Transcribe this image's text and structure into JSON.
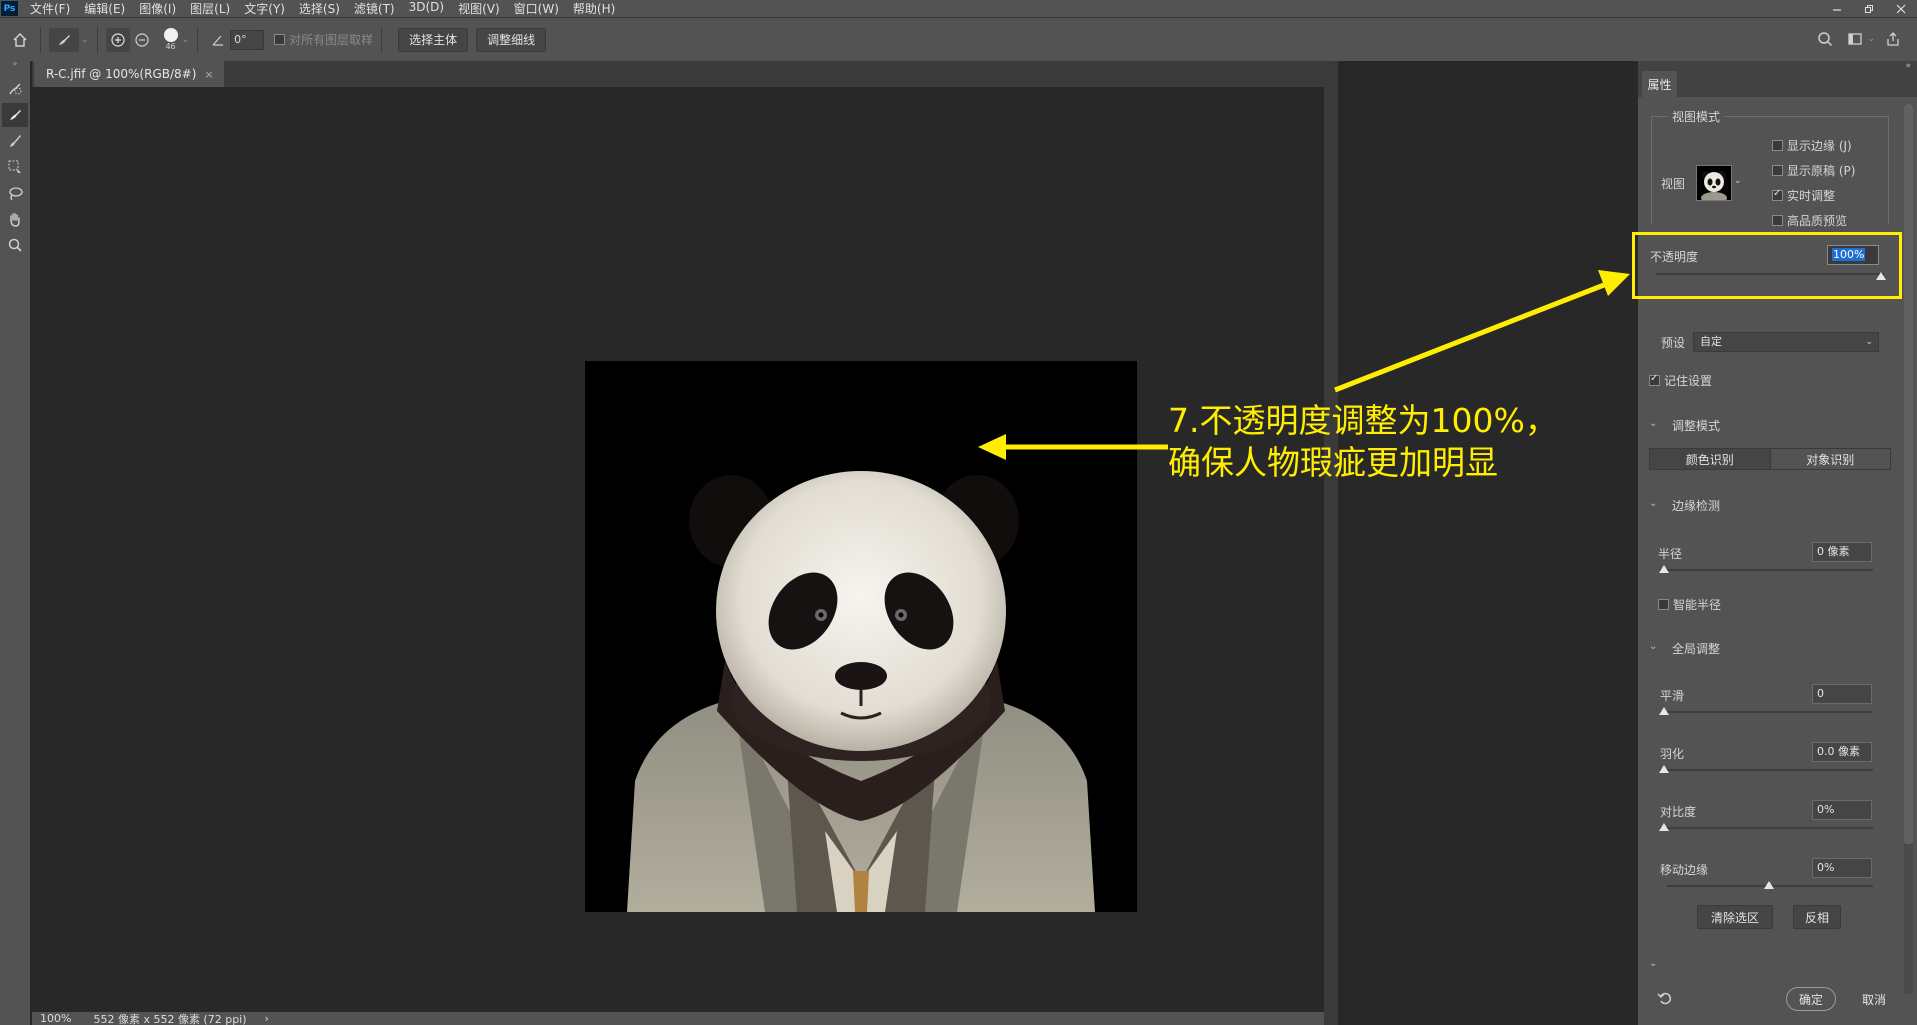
{
  "app": {
    "logo": "Ps",
    "menu": [
      "文件(F)",
      "编辑(E)",
      "图像(I)",
      "图层(L)",
      "文字(Y)",
      "选择(S)",
      "滤镜(T)",
      "3D(D)",
      "视图(V)",
      "窗口(W)",
      "帮助(H)"
    ]
  },
  "options_bar": {
    "brush_size": "46",
    "angle": "0°",
    "sample_all_layers": "对所有图层取样",
    "select_subject": "选择主体",
    "refine_hair": "调整细线"
  },
  "document": {
    "tab_title": "R-C.jfif @ 100%(RGB/8#)",
    "tab_close": "×"
  },
  "status": {
    "zoom": "100%",
    "doc_info": "552 像素 x 552 像素 (72 ppi)",
    "arrow": "›"
  },
  "annotation": {
    "line1": "7.不透明度调整为100%，",
    "line2": "确保人物瑕疵更加明显",
    "color": "#ffee00"
  },
  "properties": {
    "tab": "属性",
    "view_mode_title": "视图模式",
    "view_label": "视图",
    "show_edge": "显示边缘 (J)",
    "show_original": "显示原稿 (P)",
    "realtime": "实时调整",
    "high_quality": "高品质预览",
    "opacity_label": "不透明度",
    "opacity_value": "100%",
    "opacity_level": 100,
    "preset_label": "预设",
    "preset_value": "自定",
    "remember": "记住设置",
    "adjust_mode_title": "调整模式",
    "color_aware": "颜色识别",
    "object_aware": "对象识别",
    "edge_detect_title": "边缘检测",
    "radius_label": "半径",
    "radius_value": "0 像素",
    "smart_radius": "智能半径",
    "global_title": "全局调整",
    "smooth_label": "平滑",
    "smooth_value": "0",
    "feather_label": "羽化",
    "feather_value": "0.0 像素",
    "contrast_label": "对比度",
    "contrast_value": "0%",
    "shift_edge_label": "移动边缘",
    "shift_edge_value": "0%",
    "clear_selection": "清除选区",
    "invert": "反相",
    "ok": "确定",
    "cancel": "取消"
  }
}
